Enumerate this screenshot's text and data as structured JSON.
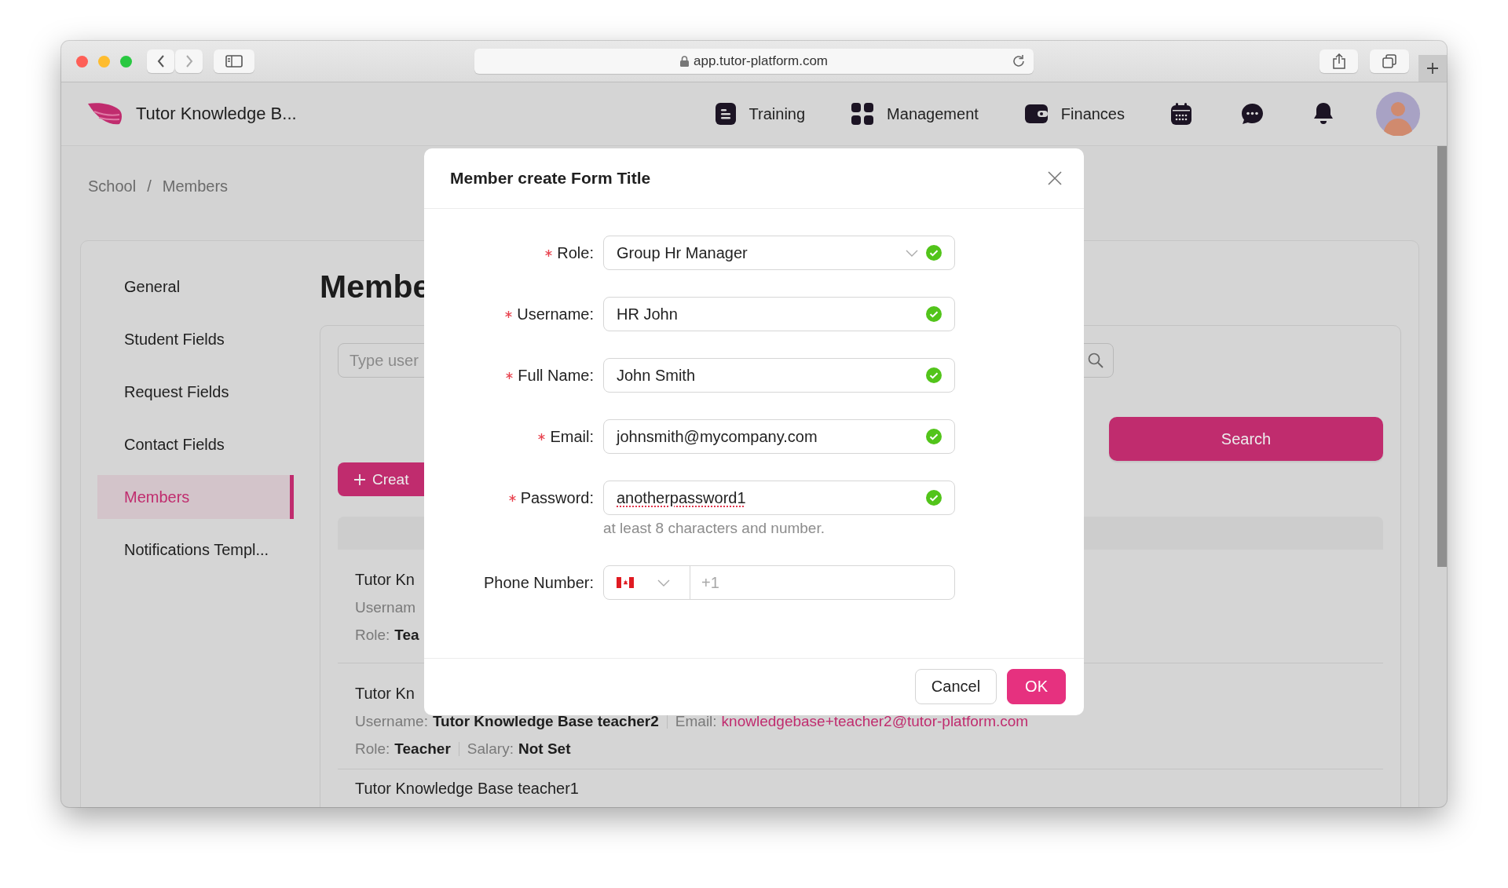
{
  "browser": {
    "url": "app.tutor-platform.com"
  },
  "header": {
    "app_name": "Tutor Knowledge B...",
    "nav": [
      {
        "label": "Training",
        "kind": "document"
      },
      {
        "label": "Management",
        "kind": "grid"
      },
      {
        "label": "Finances",
        "kind": "wallet"
      }
    ],
    "icons": [
      {
        "kind": "calendar"
      },
      {
        "kind": "chat"
      },
      {
        "kind": "bell"
      }
    ]
  },
  "breadcrumb": {
    "items": [
      "School",
      "Members"
    ],
    "separator": "/"
  },
  "sidebar": {
    "items": [
      {
        "label": "General",
        "selected": false
      },
      {
        "label": "Student Fields",
        "selected": false
      },
      {
        "label": "Request Fields",
        "selected": false
      },
      {
        "label": "Contact Fields",
        "selected": false
      },
      {
        "label": "Members",
        "selected": true
      },
      {
        "label": "Notifications Templ...",
        "selected": false
      }
    ]
  },
  "page": {
    "title": "Membe",
    "search": {
      "placeholder": "Type user"
    },
    "create_button": "Creat",
    "search_button": "Search"
  },
  "members": [
    {
      "title": "Tutor Kn",
      "lines": [
        [
          {
            "label": "Usernam"
          }
        ],
        [
          {
            "label": "Role:",
            "value": "Tea",
            "kind": "text"
          }
        ]
      ]
    },
    {
      "title": "Tutor Kn",
      "lines": [
        [
          {
            "label": "Username:",
            "value": "Tutor Knowledge Base teacher2",
            "kind": "text"
          },
          {
            "label": "Email:",
            "value": "knowledgebase+teacher2@tutor-platform.com",
            "kind": "link"
          }
        ],
        [
          {
            "label": "Role:",
            "value": "Teacher",
            "kind": "text"
          },
          {
            "label": "Salary:",
            "value": "Not Set",
            "kind": "text"
          }
        ]
      ]
    },
    {
      "title": "Tutor Knowledge Base teacher1"
    }
  ],
  "modal": {
    "title": "Member create Form Title",
    "fields": [
      {
        "label": "Role:",
        "required": true,
        "kind": "select",
        "value": "Group Hr Manager",
        "valid": true
      },
      {
        "label": "Username:",
        "required": true,
        "kind": "input",
        "value": "HR John",
        "valid": true
      },
      {
        "label": "Full Name:",
        "required": true,
        "kind": "input",
        "value": "John Smith",
        "valid": true
      },
      {
        "label": "Email:",
        "required": true,
        "kind": "input",
        "value": "johnsmith@mycompany.com",
        "valid": true
      },
      {
        "label": "Password:",
        "required": true,
        "kind": "input",
        "value": "anotherpassword1",
        "valid": true,
        "spellcheck_error": true,
        "help": "at least 8 characters and number."
      },
      {
        "label": "Phone Number:",
        "required": false,
        "kind": "phone",
        "placeholder": "+1",
        "valid": false
      }
    ],
    "buttons": [
      {
        "label": "Cancel",
        "primary": false
      },
      {
        "label": "OK",
        "primary": true
      }
    ]
  }
}
